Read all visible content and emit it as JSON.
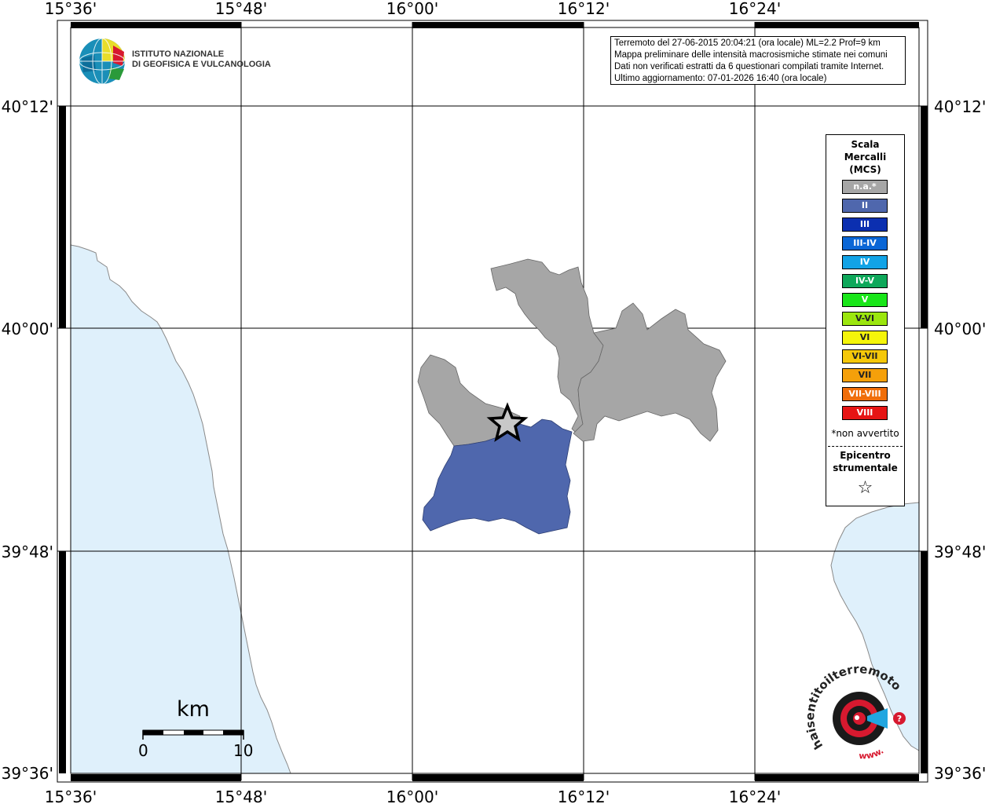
{
  "map": {
    "lon_ticks": [
      "15°36'",
      "15°48'",
      "16°00'",
      "16°12'",
      "16°24'"
    ],
    "lat_ticks": [
      "40°12'",
      "40°00'",
      "39°48'",
      "39°36'"
    ],
    "colors": {
      "sea": "#dff0fb",
      "coast": "#8a8a8a",
      "not_felt": "#a6a6a6",
      "intensity_II": "#4f67ad"
    }
  },
  "logo_ingv": {
    "line1": "ISTITUTO NAZIONALE",
    "line2": "DI GEOFISICA E VULCANOLOGIA"
  },
  "info": {
    "line1": "Terremoto del 27-06-2015 20:04:21 (ora locale) ML=2.2 Prof=9 km",
    "line2": "Mappa preliminare delle intensità macrosismiche stimate nei comuni",
    "line3": "Dati non verificati estratti da 6 questionari compilati tramite Internet.",
    "line4": "Ultimo aggiornamento: 07-01-2026 16:40 (ora locale)"
  },
  "legend": {
    "title1": "Scala",
    "title2": "Mercalli",
    "title3": "(MCS)",
    "items": [
      {
        "label": "n.a.*",
        "color": "#a6a6a6"
      },
      {
        "label": "II",
        "color": "#4f67ad"
      },
      {
        "label": "III",
        "color": "#0b2fb0"
      },
      {
        "label": "III-IV",
        "color": "#0a66d6"
      },
      {
        "label": "IV",
        "color": "#12a3e6"
      },
      {
        "label": "IV-V",
        "color": "#0ea85a"
      },
      {
        "label": "V",
        "color": "#19e619"
      },
      {
        "label": "V-VI",
        "color": "#9be60e"
      },
      {
        "label": "VI",
        "color": "#f5f50a"
      },
      {
        "label": "VI-VII",
        "color": "#f5c80a"
      },
      {
        "label": "VII",
        "color": "#f5a00a"
      },
      {
        "label": "VII-VIII",
        "color": "#f06e0a"
      },
      {
        "label": "VIII",
        "color": "#e61414"
      }
    ],
    "note": "*non avvertito",
    "epicenter1": "Epicentro",
    "epicenter2": "strumentale",
    "epicenter_icon": "star-icon"
  },
  "scalebar": {
    "unit": "km",
    "start": "0",
    "end": "10"
  },
  "logo_hsit": {
    "text": "haisentitoilterremoto.it",
    "prefix": "www."
  }
}
